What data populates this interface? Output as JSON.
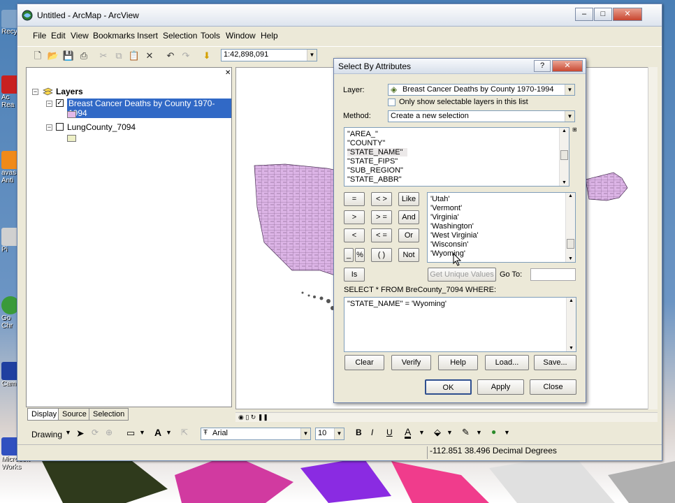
{
  "desktop": {
    "icons": [
      {
        "name": "recycle-bin-icon",
        "label": "Recy",
        "color": "#7ea2c8"
      },
      {
        "name": "acrobat-reader-icon",
        "label": "Ac Rea",
        "color": "#c82020"
      },
      {
        "name": "avast-antivirus-icon",
        "label": "avas Anti",
        "color": "#f08a1a"
      },
      {
        "name": "computer-icon",
        "label": "Pi",
        "color": "#d0d0d0"
      },
      {
        "name": "google-chrome-icon",
        "label": "Go Chr",
        "color": "#3a9a3a"
      },
      {
        "name": "camtasia-icon",
        "label": "Cam",
        "color": "#2040a0"
      },
      {
        "name": "microsoft-works-icon",
        "label": "Microsoft Works",
        "color": "#3050c0"
      }
    ]
  },
  "window": {
    "title": "Untitled - ArcMap - ArcView",
    "minimize": "–",
    "maximize": "□",
    "close": "✕"
  },
  "menu": {
    "file": "File",
    "edit": "Edit",
    "view": "View",
    "bookmarks": "Bookmarks",
    "insert": "Insert",
    "selection": "Selection",
    "tools": "Tools",
    "window": "Window",
    "help": "Help"
  },
  "toolbar": {
    "scale": "1:42,898,091"
  },
  "toc": {
    "root": "Layers",
    "layers": [
      {
        "name": "Breast Cancer Deaths by County 1970-1994",
        "checked": true,
        "color": "#e3b8e8"
      },
      {
        "name": "LungCounty_7094",
        "checked": false,
        "color": "#eef0c6"
      }
    ],
    "tabs": {
      "display": "Display",
      "source": "Source",
      "selection": "Selection"
    }
  },
  "drawing": {
    "label": "Drawing",
    "font": "Arial",
    "size": "10",
    "bold": "B",
    "italic": "I",
    "underline": "U",
    "text_tool": "A"
  },
  "status": {
    "coords": "-112.851  38.496 Decimal Degrees"
  },
  "dialog": {
    "title": "Select By Attributes",
    "layer_label": "Layer:",
    "layer_value": "Breast Cancer Deaths by County 1970-1994",
    "only_selectable": "Only show selectable layers in this list",
    "method_label": "Method:",
    "method_value": "Create a new selection",
    "fields": [
      "\"AREA_\"",
      "\"COUNTY\"",
      "\"STATE_NAME\"",
      "\"STATE_FIPS\"",
      "\"SUB_REGION\"",
      "\"STATE_ABBR\""
    ],
    "operators": {
      "eq": "=",
      "ne": "< >",
      "like": "Like",
      "gt": ">",
      "ge": "> =",
      "and": "And",
      "lt": "<",
      "le": "< =",
      "or": "Or",
      "underscore": "_",
      "percent": "%",
      "parens": "( )",
      "not": "Not",
      "is": "Is"
    },
    "values": [
      "'Utah'",
      "'Vermont'",
      "'Virginia'",
      "'Washington'",
      "'West Virginia'",
      "'Wisconsin'",
      "'Wyoming'"
    ],
    "get_unique": "Get Unique Values",
    "goto_label": "Go To:",
    "goto_value": "",
    "sql_prefix": "SELECT * FROM BreCounty_7094 WHERE:",
    "expression": "\"STATE_NAME\" = 'Wyoming'",
    "clear": "Clear",
    "verify": "Verify",
    "help": "Help",
    "load": "Load...",
    "save": "Save...",
    "ok": "OK",
    "apply": "Apply",
    "close": "Close"
  }
}
